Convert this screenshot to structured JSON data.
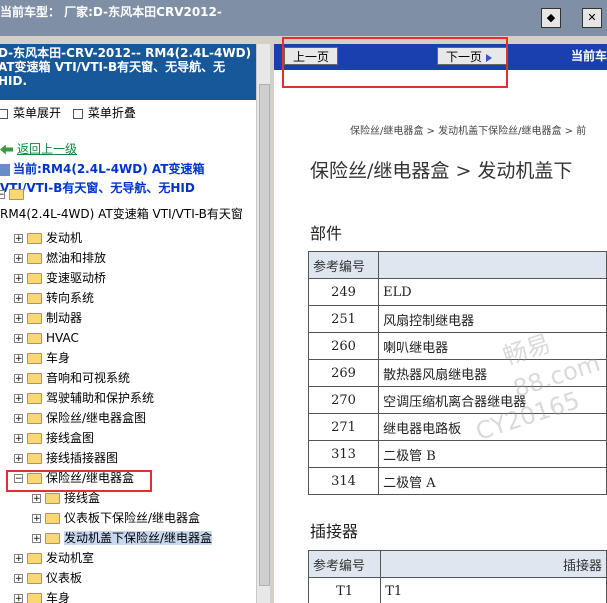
{
  "titlebar": {
    "title": "当前车型：  厂家:D-东风本田CRV2012-",
    "btn1_icon": "diamond-nav-icon",
    "btn2_icon": "close-icon"
  },
  "vehicle_header": {
    "line1": "D-东风本田-CRV-2012-- RM4(2.4L-4WD)",
    "line2": "AT变速箱 VTI/VTI-B有天窗、无导航、无",
    "line3": "HID."
  },
  "menu": {
    "expand": "菜单展开",
    "collapse": "菜单折叠"
  },
  "back_link": "返回上一级",
  "current": {
    "line1": "当前:RM4(2.4L-4WD) AT变速箱",
    "line2": "VTI/VTI-B有天窗、无导航、无HID"
  },
  "tree": {
    "root": "RM4(2.4L-4WD) AT变速箱 VTI/VTI-B有天窗",
    "items": [
      {
        "label": "发动机"
      },
      {
        "label": "燃油和排放"
      },
      {
        "label": "变速驱动桥"
      },
      {
        "label": "转向系统"
      },
      {
        "label": "制动器"
      },
      {
        "label": "HVAC"
      },
      {
        "label": "车身"
      },
      {
        "label": "音响和可视系统"
      },
      {
        "label": "驾驶辅助和保护系统"
      },
      {
        "label": "保险丝/继电器盒图"
      },
      {
        "label": "接线盒图"
      },
      {
        "label": "接线插接器图"
      },
      {
        "label": "保险丝/继电器盒"
      },
      {
        "label": "接线盒"
      },
      {
        "label": "仪表板下保险丝/继电器盒"
      },
      {
        "label": "发动机盖下保险丝/继电器盒"
      },
      {
        "label": "发动机室"
      },
      {
        "label": "仪表板"
      },
      {
        "label": "车身"
      }
    ]
  },
  "nav": {
    "prev": "上一页",
    "next": "下一页",
    "current_label": "当前车"
  },
  "breadcrumb": "保险丝/继电器盒  >  发动机盖下保险丝/继电器盒  >  前",
  "page_title": "保险丝/继电器盒  >  发动机盖下",
  "parts": {
    "heading": "部件",
    "col1": "参考编号",
    "col2": "",
    "rows": [
      [
        "249",
        "ELD"
      ],
      [
        "251",
        "风扇控制继电器"
      ],
      [
        "260",
        "喇叭继电器"
      ],
      [
        "269",
        "散热器风扇继电器"
      ],
      [
        "270",
        "空调压缩机离合器继电器"
      ],
      [
        "271",
        "继电器电路板"
      ],
      [
        "313",
        "二极管 B"
      ],
      [
        "314",
        "二极管 A"
      ]
    ]
  },
  "connectors": {
    "heading": "插接器",
    "col1": "参考编号",
    "col2": "插接器",
    "rows": [
      [
        "T1",
        "T1"
      ]
    ]
  },
  "watermark": {
    "line1": "畅易",
    "line2": "88.com",
    "line3": "CY20165"
  }
}
